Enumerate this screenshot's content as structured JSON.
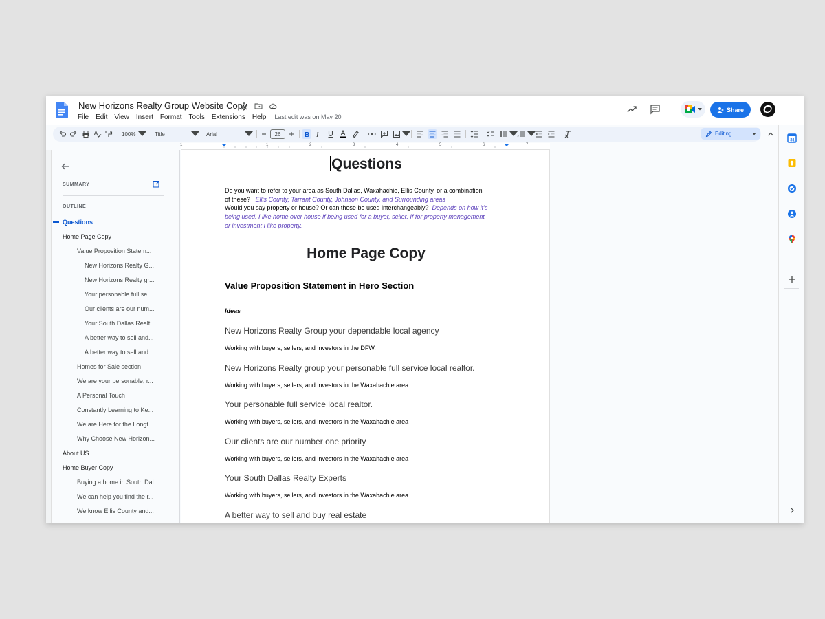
{
  "document": {
    "title": "New Horizons Realty Group Website Copy",
    "last_edit": "Last edit was on May 20"
  },
  "menu": [
    "File",
    "Edit",
    "View",
    "Insert",
    "Format",
    "Tools",
    "Extensions",
    "Help"
  ],
  "header": {
    "share_label": "Share"
  },
  "toolbar": {
    "zoom": "100%",
    "style": "Title",
    "font": "Arial",
    "font_size": "26",
    "mode": "Editing"
  },
  "ruler": [
    "1",
    "1",
    "2",
    "3",
    "4",
    "5",
    "6",
    "7"
  ],
  "outline": {
    "summary_label": "SUMMARY",
    "outline_label": "OUTLINE",
    "items": [
      {
        "text": "Questions",
        "level": 1,
        "active": true
      },
      {
        "text": "Home Page Copy",
        "level": 1
      },
      {
        "text": "Value Proposition Statem...",
        "level": 2
      },
      {
        "text": "New Horizons Realty G...",
        "level": 3
      },
      {
        "text": "New Horizons Realty gr...",
        "level": 3
      },
      {
        "text": "Your personable full se...",
        "level": 3
      },
      {
        "text": "Our clients are our num...",
        "level": 3
      },
      {
        "text": "Your South Dallas Realt...",
        "level": 3
      },
      {
        "text": "A better way to sell and...",
        "level": 3
      },
      {
        "text": "A better way to sell and...",
        "level": 3
      },
      {
        "text": "Homes for Sale section",
        "level": 2
      },
      {
        "text": "We are your personable, r...",
        "level": 2
      },
      {
        "text": "A Personal Touch",
        "level": 2
      },
      {
        "text": "Constantly Learning to Ke...",
        "level": 2
      },
      {
        "text": "We are Here for the Longt...",
        "level": 2
      },
      {
        "text": "Why Choose New Horizon...",
        "level": 2
      },
      {
        "text": "About US",
        "level": 1
      },
      {
        "text": "Home Buyer Copy",
        "level": 1
      },
      {
        "text": "Buying a home in South Dall...",
        "level": 2
      },
      {
        "text": "We can help you find the r...",
        "level": 2
      },
      {
        "text": "We know Ellis County and...",
        "level": 2
      }
    ]
  },
  "content": {
    "title": "Questions",
    "q1_line1": "Do you want to refer to your area as South Dallas, Waxahachie, Ellis County, or a combination",
    "q1_line2": "of these?",
    "q1_answer": "Ellis County, Tarrant County, Johnson County, and Surrounding areas",
    "q2_text": "Would you say property or house? Or can these be used interchangeably?",
    "q2_answer_a": "Depends on how it's",
    "q2_answer_b": "being used.  I like home over house if being used for a buyer, seller.  If for property management",
    "q2_answer_c": "or investment I like property.",
    "home_title": "Home Page Copy",
    "vp_heading": "Value Proposition Statement in Hero Section",
    "ideas_label": "Ideas",
    "ideas": [
      {
        "tagline": "New Horizons Realty Group your dependable local agency",
        "sub": "Working with buyers, sellers, and investors in the DFW."
      },
      {
        "tagline": "New Horizons Realty group your personable full service local realtor.",
        "sub": "Working with buyers, sellers, and investors in the Waxahachie area"
      },
      {
        "tagline": "Your personable full service local realtor.",
        "sub": "Working with buyers, sellers, and investors in the Waxahachie area"
      },
      {
        "tagline": "Our clients are our number one priority",
        "sub": "Working with buyers, sellers, and investors in the Waxahachie area"
      },
      {
        "tagline": "Your South Dallas Realty Experts",
        "sub": "Working with buyers, sellers, and investors in the Waxahachie area"
      },
      {
        "tagline": "A better way to sell and buy real estate",
        "sub": ""
      }
    ]
  },
  "colors": {
    "accent": "#1a73e8",
    "answer_text": "#5b3fbb",
    "active_outline": "#0b57d0"
  }
}
